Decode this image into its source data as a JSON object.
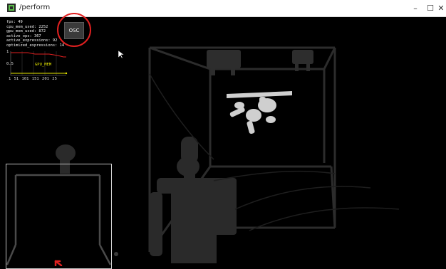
{
  "window": {
    "title": "/perform",
    "min_label": "–",
    "max_label": "☐",
    "close_label": "✕"
  },
  "stats": [
    "fps: 49",
    "cpu_mem_used: 2252",
    "gpu_mem_used: 872",
    "active_ops: 367",
    "active_expressions: 92",
    "optimized_expressions: 14"
  ],
  "osc_button": {
    "label": "OSC"
  },
  "graph": {
    "y_max": "1",
    "y_mid": "0.5",
    "series_label": "GPU_MEM",
    "x_ticks": "1  51  101  151  201  25"
  },
  "colors": {
    "background": "#000000",
    "annotation": "#e02020",
    "graph_series": "#e8e800"
  }
}
